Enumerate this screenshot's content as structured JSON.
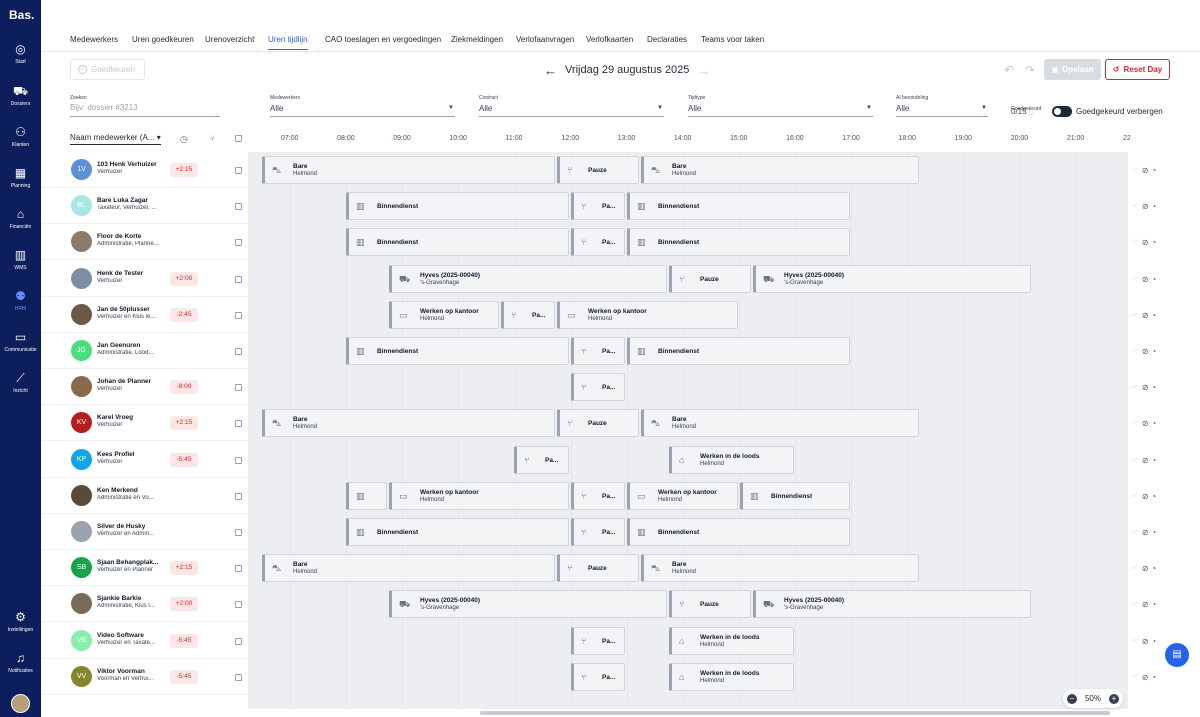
{
  "app": {
    "logo": "Bas."
  },
  "sidebar": {
    "items": [
      {
        "label": "Start",
        "icon": "dashboard-icon",
        "active": false
      },
      {
        "label": "Dossiers",
        "icon": "truck-icon",
        "active": false
      },
      {
        "label": "Klanten",
        "icon": "users-icon",
        "active": false
      },
      {
        "label": "Planning",
        "icon": "calendar-icon",
        "active": false
      },
      {
        "label": "Financiën",
        "icon": "bank-icon",
        "active": false
      },
      {
        "label": "WMS",
        "icon": "warehouse-icon",
        "active": false
      },
      {
        "label": "HRM",
        "icon": "team-icon",
        "active": true
      },
      {
        "label": "Communicatie",
        "icon": "chat-icon",
        "active": false
      },
      {
        "label": "Inzicht",
        "icon": "chart-icon",
        "active": false
      },
      {
        "label": "Instellingen",
        "icon": "gear-icon",
        "active": false
      },
      {
        "label": "Notificaties",
        "icon": "bell-icon",
        "active": false
      }
    ]
  },
  "tabs": [
    {
      "label": "Medewerkers",
      "active": false
    },
    {
      "label": "Uren goedkeuren",
      "active": false
    },
    {
      "label": "Urenoverzicht",
      "active": false
    },
    {
      "label": "Uren tijdlijn",
      "active": true
    },
    {
      "label": "CAO toeslagen en vergoedingen",
      "active": false
    },
    {
      "label": "Ziekmeldingen",
      "active": false
    },
    {
      "label": "Verlofaanvragen",
      "active": false
    },
    {
      "label": "Verlofkaarten",
      "active": false
    },
    {
      "label": "Declaraties",
      "active": false
    },
    {
      "label": "Teams voor taken",
      "active": false
    }
  ],
  "toolbar": {
    "approve_label": "Goedkeuren",
    "date_label": "Vrijdag 29 augustus 2025",
    "save_label": "Opslaan",
    "reset_label": "Reset Day"
  },
  "filters": {
    "search": {
      "label": "Zoeken",
      "placeholder": "Bijv: dossier #3213"
    },
    "employees": {
      "label": "Medewerkers",
      "value": "Alle"
    },
    "contract": {
      "label": "Contract",
      "value": "Alle"
    },
    "timetype": {
      "label": "Tijdtype",
      "value": "Alle"
    },
    "assessment": {
      "label": "AI beoordeling",
      "value": "Alle"
    },
    "approved": {
      "label": "Goedgekeurd",
      "value": "0/15"
    },
    "hide_approved_label": "Goedgekeurd verbergen"
  },
  "grid": {
    "sort_label": "Naam medewerker (A...",
    "hours": [
      "07:00",
      "08:00",
      "09:00",
      "10:00",
      "11:00",
      "12:00",
      "13:00",
      "14:00",
      "15:00",
      "16:00",
      "17:00",
      "18:00",
      "19:00",
      "20:00",
      "21:00",
      "22"
    ]
  },
  "employees": [
    {
      "name": "103 Henk Verhuizer",
      "role": "Verhuizer",
      "initials": "1V",
      "color": "#5b8fd6",
      "badge": "+2:15",
      "blocks": [
        [
          "Bare",
          "Helmond",
          "cart-icon",
          262,
          555
        ],
        [
          "Pauze",
          "",
          "fork-icon",
          557,
          639
        ],
        [
          "Bare",
          "Helmond",
          "cart-icon",
          641,
          919
        ]
      ]
    },
    {
      "name": "Bare Luka Zagar",
      "role": "Taxateur, Verhuizer, ...",
      "initials": "BL",
      "color": "#a8e6e0",
      "badge": "",
      "blocks": [
        [
          "Binnendienst",
          "",
          "building-icon",
          346,
          569
        ],
        [
          "Pa...",
          "",
          "fork-icon",
          571,
          625
        ],
        [
          "Binnendienst",
          "",
          "building-icon",
          627,
          850
        ]
      ]
    },
    {
      "name": "Floor de Korte",
      "role": "Administratie, Planne...",
      "initials": "",
      "color": "#8c7b6a",
      "badge": "",
      "blocks": [
        [
          "Binnendienst",
          "",
          "building-icon",
          346,
          569
        ],
        [
          "Pa...",
          "",
          "fork-icon",
          571,
          625
        ],
        [
          "Binnendienst",
          "",
          "building-icon",
          627,
          850
        ]
      ]
    },
    {
      "name": "Henk de Tester",
      "role": "Verhuizer",
      "initials": "",
      "color": "#7a8fa6",
      "badge": "+2:00",
      "blocks": [
        [
          "Hyves (2025-00040)",
          "'s-Gravenhage",
          "van-icon",
          389,
          667
        ],
        [
          "Pauze",
          "",
          "fork-icon",
          669,
          751
        ],
        [
          "Hyves (2025-00040)",
          "'s-Gravenhage",
          "van-icon",
          753,
          1031
        ]
      ]
    },
    {
      "name": "Jan de 50plusser",
      "role": "Verhuizer en Klus le...",
      "initials": "",
      "color": "#6b5a48",
      "badge": "-2:45",
      "blocks": [
        [
          "Werken op kantoor",
          "Helmond",
          "monitor-icon",
          389,
          499
        ],
        [
          "Pa...",
          "",
          "fork-icon",
          501,
          555
        ],
        [
          "Werken op kantoor",
          "Helmond",
          "monitor-icon",
          557,
          738
        ]
      ]
    },
    {
      "name": "Jan Geenuren",
      "role": "Administratie, Lood...",
      "initials": "JG",
      "color": "#4ade80",
      "badge": "",
      "blocks": [
        [
          "Binnendienst",
          "",
          "building-icon",
          346,
          569
        ],
        [
          "Pa...",
          "",
          "fork-icon",
          571,
          625
        ],
        [
          "Binnendienst",
          "",
          "building-icon",
          627,
          850
        ]
      ]
    },
    {
      "name": "Johan de Planner",
      "role": "Verhuizer",
      "initials": "",
      "color": "#8b6a4a",
      "badge": "-8:00",
      "blocks": [
        [
          "Pa...",
          "",
          "fork-icon",
          571,
          625
        ]
      ]
    },
    {
      "name": "Karel Vroeg",
      "role": "Verhuizer",
      "initials": "KV",
      "color": "#b91c1c",
      "badge": "+2:15",
      "blocks": [
        [
          "Bare",
          "Helmond",
          "cart-icon",
          262,
          555
        ],
        [
          "Pauze",
          "",
          "fork-icon",
          557,
          639
        ],
        [
          "Bare",
          "Helmond",
          "cart-icon",
          641,
          919
        ]
      ]
    },
    {
      "name": "Kees Profiel",
      "role": "Verhuizer",
      "initials": "KP",
      "color": "#0ea5e9",
      "badge": "-5:45",
      "blocks": [
        [
          "Pa...",
          "",
          "fork-icon",
          514,
          569
        ],
        [
          "Werken in de loods",
          "Helmond",
          "warehouse-icon",
          669,
          794
        ]
      ]
    },
    {
      "name": "Ken Merkend",
      "role": "Administratie en Vo...",
      "initials": "",
      "color": "#5a4a3a",
      "badge": "",
      "blocks": [
        [
          "",
          "",
          "building-icon",
          346,
          387
        ],
        [
          "Werken op kantoor",
          "Helmond",
          "monitor-icon",
          389,
          569
        ],
        [
          "Pa...",
          "",
          "fork-icon",
          571,
          625
        ],
        [
          "Werken op kantoor",
          "Helmond",
          "monitor-icon",
          627,
          738
        ],
        [
          "Binnendienst",
          "",
          "building-icon",
          740,
          850
        ]
      ]
    },
    {
      "name": "Silver de Husky",
      "role": "Verhuizer en Admin...",
      "initials": "",
      "color": "#9aa3ad",
      "badge": "",
      "blocks": [
        [
          "Binnendienst",
          "",
          "building-icon",
          346,
          569
        ],
        [
          "Pa...",
          "",
          "fork-icon",
          571,
          625
        ],
        [
          "Binnendienst",
          "",
          "building-icon",
          627,
          850
        ]
      ]
    },
    {
      "name": "Sjaan Behangplak...",
      "role": "Verhuizer en Planner",
      "initials": "SB",
      "color": "#16a34a",
      "badge": "+2:15",
      "blocks": [
        [
          "Bare",
          "Helmond",
          "cart-icon",
          262,
          555
        ],
        [
          "Pauze",
          "",
          "fork-icon",
          557,
          639
        ],
        [
          "Bare",
          "Helmond",
          "cart-icon",
          641,
          919
        ]
      ]
    },
    {
      "name": "Sjankie Barkie",
      "role": "Administratie, Klus l...",
      "initials": "",
      "color": "#7a6a5a",
      "badge": "+2:00",
      "blocks": [
        [
          "Hyves (2025-00040)",
          "'s-Gravenhage",
          "van-icon",
          389,
          667
        ],
        [
          "Pauze",
          "",
          "fork-icon",
          669,
          751
        ],
        [
          "Hyves (2025-00040)",
          "'s-Gravenhage",
          "van-icon",
          753,
          1031
        ]
      ]
    },
    {
      "name": "Video Software",
      "role": "Verhuizer en Taxate...",
      "initials": "VS",
      "color": "#86efac",
      "badge": "-5:45",
      "blocks": [
        [
          "Pa...",
          "",
          "fork-icon",
          571,
          625
        ],
        [
          "Werken in de loods",
          "Helmond",
          "warehouse-icon",
          669,
          794
        ]
      ]
    },
    {
      "name": "Viktor Voorman",
      "role": "Voorman en Verhui...",
      "initials": "VV",
      "color": "#84852c",
      "badge": "-5:45",
      "blocks": [
        [
          "Pa...",
          "",
          "fork-icon",
          571,
          625
        ],
        [
          "Werken in de loods",
          "Helmond",
          "warehouse-icon",
          669,
          794
        ]
      ]
    }
  ],
  "zoom": {
    "value": "50%"
  }
}
